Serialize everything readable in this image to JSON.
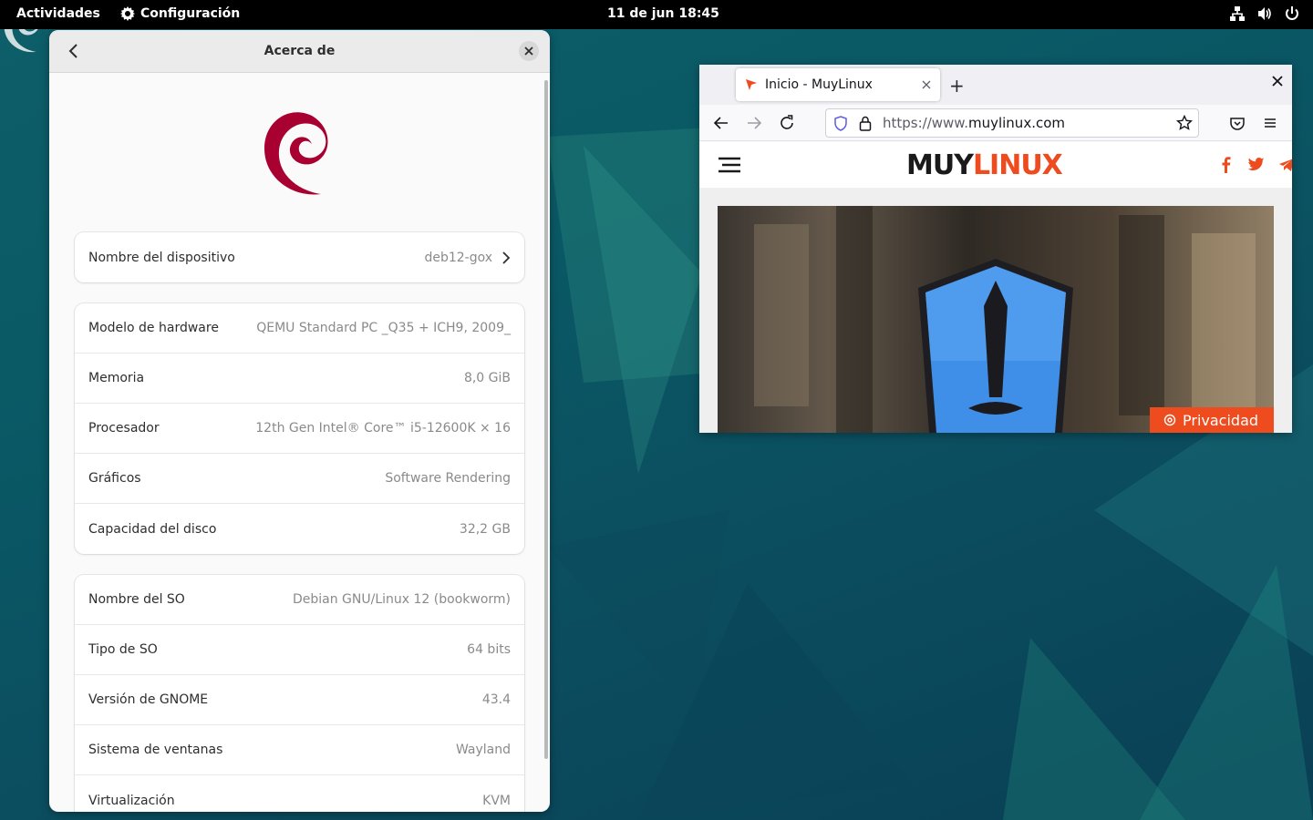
{
  "topbar": {
    "activities": "Actividades",
    "app_name": "Configuración",
    "clock": "11 de jun  18:45"
  },
  "settings": {
    "title": "Acerca de",
    "device": {
      "label": "Nombre del dispositivo",
      "value": "deb12-gox"
    },
    "hardware": [
      {
        "label": "Modelo de hardware",
        "value": "QEMU Standard PC _Q35 + ICH9, 2009_"
      },
      {
        "label": "Memoria",
        "value": "8,0 GiB"
      },
      {
        "label": "Procesador",
        "value": "12th Gen Intel® Core™ i5-12600K × 16"
      },
      {
        "label": "Gráficos",
        "value": "Software Rendering"
      },
      {
        "label": "Capacidad del disco",
        "value": "32,2 GB"
      }
    ],
    "software": [
      {
        "label": "Nombre del SO",
        "value": "Debian GNU/Linux 12 (bookworm)"
      },
      {
        "label": "Tipo de SO",
        "value": "64 bits"
      },
      {
        "label": "Versión de GNOME",
        "value": "43.4"
      },
      {
        "label": "Sistema de ventanas",
        "value": "Wayland"
      },
      {
        "label": "Virtualización",
        "value": "KVM"
      }
    ]
  },
  "browser": {
    "tab_title": "Inicio - MuyLinux",
    "url_prefix": "https://www.",
    "url_domain": "muylinux.com",
    "site_logo_part1": "MUY",
    "site_logo_part2": "LINUX",
    "privacy_label": "Privacidad",
    "colors": {
      "brand_orange": "#ee4b1f",
      "logo_dark": "#1a1a1a"
    }
  },
  "colors": {
    "debian_red": "#a80030",
    "topbar": "#000000"
  }
}
